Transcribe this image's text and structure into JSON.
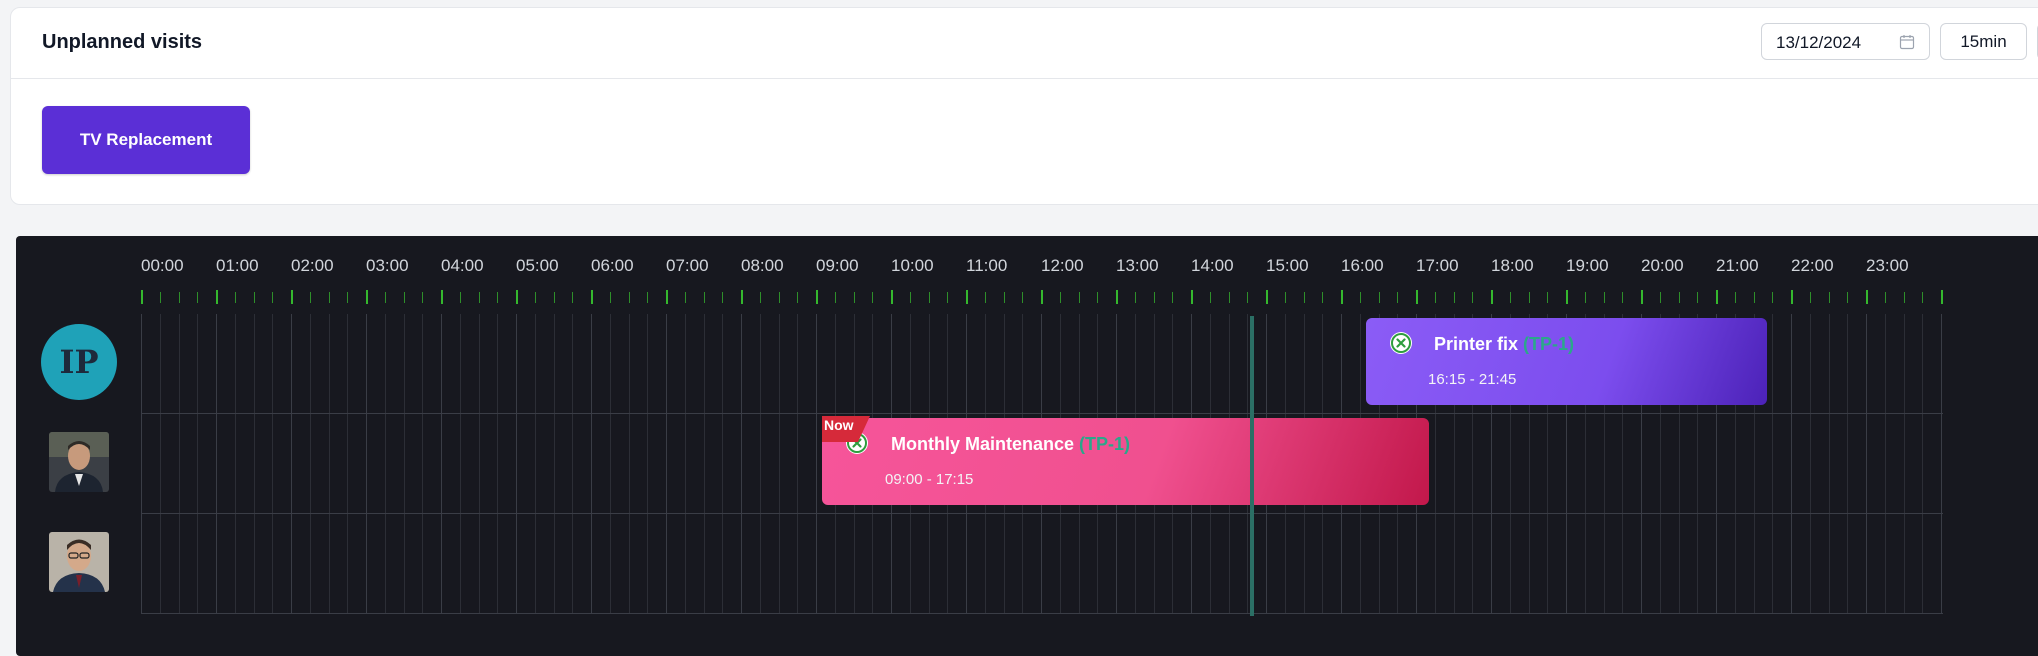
{
  "header": {
    "title": "Unplanned visits",
    "date_value": "13/12/2024",
    "interval_label": "15min"
  },
  "unplanned": {
    "visit_label": "TV Replacement"
  },
  "timeline": {
    "hours": [
      "00:00",
      "01:00",
      "02:00",
      "03:00",
      "04:00",
      "05:00",
      "06:00",
      "07:00",
      "08:00",
      "09:00",
      "10:00",
      "11:00",
      "12:00",
      "13:00",
      "14:00",
      "15:00",
      "16:00",
      "17:00",
      "18:00",
      "19:00",
      "20:00",
      "21:00",
      "22:00",
      "23:00"
    ],
    "now_label": "Now"
  },
  "resources": [
    {
      "initials": "IP",
      "type": "initials"
    },
    {
      "type": "photo"
    },
    {
      "type": "photo"
    }
  ],
  "events": [
    {
      "title": "Printer fix",
      "code": "(TP-1)",
      "time": "16:15 - 21:45"
    },
    {
      "title": "Monthly Maintenance",
      "code": "(TP-1)",
      "time": "09:00 - 17:15"
    }
  ],
  "colors": {
    "accent_purple": "#5b2fd6",
    "event_purple": "#8b5cf6",
    "event_pink": "#f0538f",
    "tick_green": "#35b82e",
    "code_teal": "#2aa88a"
  }
}
